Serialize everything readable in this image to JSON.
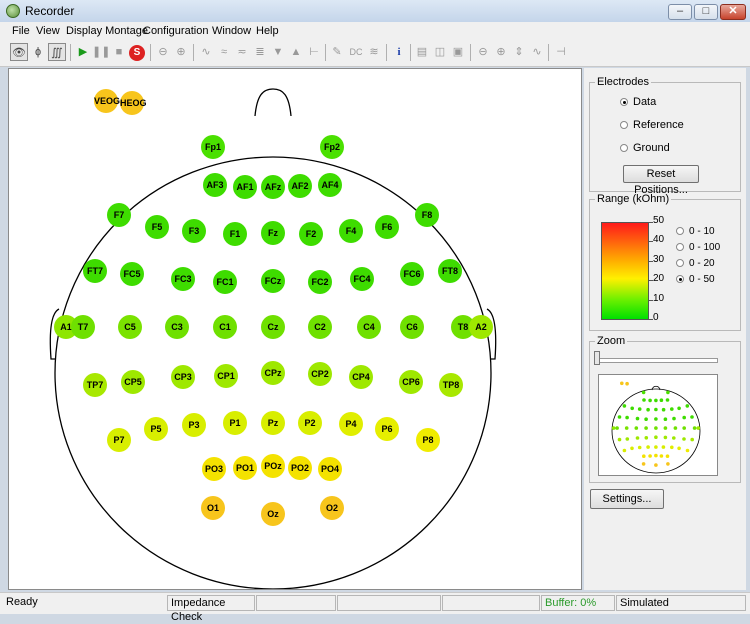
{
  "window": {
    "title": "Recorder",
    "minimize": "–",
    "maximize": "□",
    "close": "✕"
  },
  "menu": [
    "File",
    "View",
    "Display Montage",
    "Configuration",
    "Window",
    "Help"
  ],
  "toolbar": {
    "info_label": "i",
    "stop_label": "S",
    "icons": [
      "eye-icon",
      "impedance-probe-icon",
      "signal-icon",
      "play-icon",
      "pause-icon",
      "stop-square-icon",
      "stop-recording-icon",
      "zoom-out-icon",
      "zoom-in-icon",
      "waveform-icon",
      "wave-amplitude-icon",
      "wave-flat-icon",
      "montage-icon",
      "triangle-down-icon",
      "triangle-up-icon",
      "marker-icon",
      "pen-icon",
      "dc-correction-icon",
      "filter-icon",
      "info-icon",
      "layout-1-icon",
      "layout-2-icon",
      "layout-3-icon",
      "zoom-out-2-icon",
      "zoom-in-2-icon",
      "scale-icon",
      "wave-icon",
      "baseline-icon"
    ]
  },
  "electrodes": [
    {
      "label": "VEOG",
      "color": "#f7c51c"
    },
    {
      "label": "HEOG",
      "color": "#f7c51c"
    },
    {
      "label": "Fp1",
      "color": "#4ae000"
    },
    {
      "label": "Fp2",
      "color": "#4ae000"
    },
    {
      "label": "AF3",
      "color": "#3edc00"
    },
    {
      "label": "AF1",
      "color": "#3edc00"
    },
    {
      "label": "AFz",
      "color": "#3edc00"
    },
    {
      "label": "AF2",
      "color": "#3edc00"
    },
    {
      "label": "AF4",
      "color": "#3edc00"
    },
    {
      "label": "F7",
      "color": "#3edc00"
    },
    {
      "label": "F5",
      "color": "#3edc00"
    },
    {
      "label": "F3",
      "color": "#3edc00"
    },
    {
      "label": "F1",
      "color": "#3edc00"
    },
    {
      "label": "Fz",
      "color": "#3edc00"
    },
    {
      "label": "F2",
      "color": "#3edc00"
    },
    {
      "label": "F4",
      "color": "#3edc00"
    },
    {
      "label": "F6",
      "color": "#3edc00"
    },
    {
      "label": "F8",
      "color": "#3edc00"
    },
    {
      "label": "FT7",
      "color": "#3edc00"
    },
    {
      "label": "FC5",
      "color": "#3edc00"
    },
    {
      "label": "FC3",
      "color": "#3edc00"
    },
    {
      "label": "FC1",
      "color": "#3edc00"
    },
    {
      "label": "FCz",
      "color": "#3edc00"
    },
    {
      "label": "FC2",
      "color": "#3edc00"
    },
    {
      "label": "FC4",
      "color": "#3edc00"
    },
    {
      "label": "FC6",
      "color": "#3edc00"
    },
    {
      "label": "FT8",
      "color": "#3edc00"
    },
    {
      "label": "A1",
      "color": "#8ee600"
    },
    {
      "label": "T7",
      "color": "#6fe000"
    },
    {
      "label": "C5",
      "color": "#7ae200"
    },
    {
      "label": "C3",
      "color": "#6fe000"
    },
    {
      "label": "C1",
      "color": "#6fe000"
    },
    {
      "label": "Cz",
      "color": "#6fe000"
    },
    {
      "label": "C2",
      "color": "#6fe000"
    },
    {
      "label": "C4",
      "color": "#6fe000"
    },
    {
      "label": "C6",
      "color": "#6fe000"
    },
    {
      "label": "T8",
      "color": "#6fe000"
    },
    {
      "label": "A2",
      "color": "#9ee800"
    },
    {
      "label": "TP7",
      "color": "#a8e800"
    },
    {
      "label": "CP5",
      "color": "#9ee800"
    },
    {
      "label": "CP3",
      "color": "#9ee800"
    },
    {
      "label": "CP1",
      "color": "#9ee800"
    },
    {
      "label": "CPz",
      "color": "#9ee800"
    },
    {
      "label": "CP2",
      "color": "#9ee800"
    },
    {
      "label": "CP4",
      "color": "#9ee800"
    },
    {
      "label": "CP6",
      "color": "#9ee800"
    },
    {
      "label": "TP8",
      "color": "#a8e800"
    },
    {
      "label": "P7",
      "color": "#d8ee00"
    },
    {
      "label": "P5",
      "color": "#d8ee00"
    },
    {
      "label": "P3",
      "color": "#d8ee00"
    },
    {
      "label": "P1",
      "color": "#d8ee00"
    },
    {
      "label": "Pz",
      "color": "#d8ee00"
    },
    {
      "label": "P2",
      "color": "#d8ee00"
    },
    {
      "label": "P4",
      "color": "#e0ee00"
    },
    {
      "label": "P6",
      "color": "#e6ee00"
    },
    {
      "label": "P8",
      "color": "#f0ec00"
    },
    {
      "label": "PO3",
      "color": "#f4e200"
    },
    {
      "label": "PO1",
      "color": "#f4e200"
    },
    {
      "label": "POz",
      "color": "#f4e200"
    },
    {
      "label": "PO2",
      "color": "#f4e200"
    },
    {
      "label": "PO4",
      "color": "#f4e200"
    },
    {
      "label": "O1",
      "color": "#f7c51c"
    },
    {
      "label": "Oz",
      "color": "#f7c51c"
    },
    {
      "label": "O2",
      "color": "#f7c51c"
    }
  ],
  "electrodes_group": {
    "title": "Electrodes",
    "options": [
      {
        "label": "Data",
        "selected": true
      },
      {
        "label": "Reference",
        "selected": false
      },
      {
        "label": "Ground",
        "selected": false
      }
    ],
    "reset_button": "Reset Positions..."
  },
  "range_group": {
    "title": "Range (kOhm)",
    "ticks": [
      "50",
      "40",
      "30",
      "20",
      "10",
      "0"
    ],
    "options": [
      {
        "label": "0 - 10",
        "selected": false
      },
      {
        "label": "0 - 100",
        "selected": false
      },
      {
        "label": "0 - 20",
        "selected": false
      },
      {
        "label": "0 - 50",
        "selected": true
      }
    ]
  },
  "zoom_group": {
    "title": "Zoom",
    "level": 0
  },
  "settings_button": "Settings...",
  "status": {
    "ready": "Ready",
    "mode": "Impedance Check",
    "buffer": "Buffer: 0%",
    "simulated": "Simulated"
  },
  "colors": {
    "buffer_text": "#2a9a2a",
    "selected_title_bg": "#c4d5ea"
  }
}
